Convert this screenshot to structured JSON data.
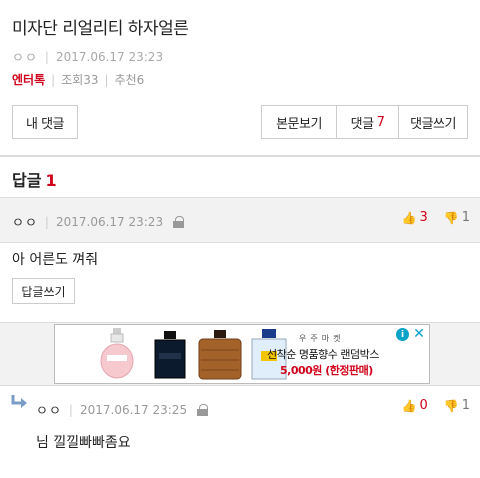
{
  "post": {
    "title": "미자단 리얼리티 하자얼른",
    "author": "ㅇㅇ",
    "date": "2017.06.17 23:23",
    "category": "엔터톡",
    "views": "조회33",
    "recommends": "추천6"
  },
  "toolbar": {
    "my_comments": "내 댓글",
    "view_post": "본문보기",
    "comments_label": "댓글",
    "comments_count": "7",
    "write_comment": "댓글쓰기"
  },
  "replies_section": {
    "title": "답글",
    "count": "1"
  },
  "reply1": {
    "author": "ㅇㅇ",
    "date": "2017.06.17 23:23",
    "upvotes": "3",
    "downvotes": "1",
    "body": "아 어른도 껴줘",
    "reply_button": "답글쓰기"
  },
  "ad": {
    "brand": "우주마켓",
    "headline": "선착순 명품향수 랜덤박스",
    "price": "5,000원 (한정판매)",
    "info_icon": "i",
    "close_icon": "✕"
  },
  "reply2": {
    "author": "ㅇㅇ",
    "date": "2017.06.17 23:25",
    "upvotes": "0",
    "downvotes": "1",
    "body": "님 낄낄빠빠좀요"
  },
  "colors": {
    "accent_red": "#d0021b",
    "ad_blue": "#0aa2c8",
    "bar_gray": "#f2f2f2"
  }
}
